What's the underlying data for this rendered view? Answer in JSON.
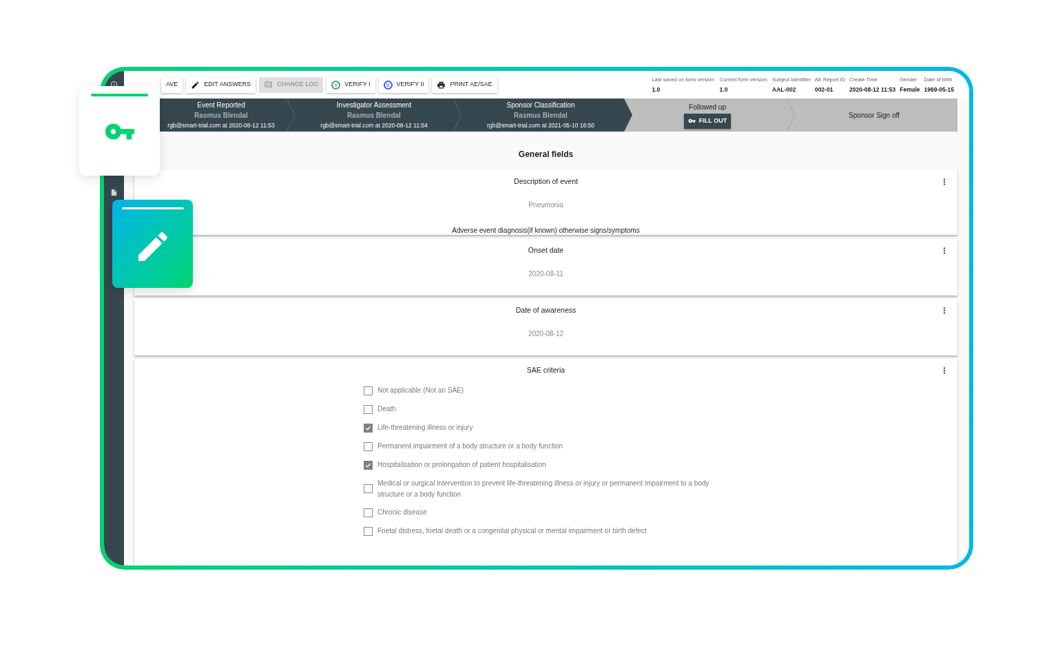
{
  "toolbar": {
    "buttons": [
      {
        "kind": "plain",
        "label": "AVE",
        "disabled": false
      },
      {
        "kind": "pencil",
        "label": "EDIT ANSWERS",
        "disabled": false
      },
      {
        "kind": "comment",
        "label": "CHANGE LOG",
        "disabled": true
      },
      {
        "kind": "verify",
        "label": "VERIFY I",
        "badge": "V",
        "color": "#4c9a7f",
        "disabled": false
      },
      {
        "kind": "verify",
        "label": "VERIFY II",
        "badge": "V",
        "color": "#3d5afe",
        "disabled": false
      },
      {
        "kind": "print",
        "label": "PRINT AE/SAE",
        "disabled": false
      }
    ]
  },
  "record_info": [
    {
      "label": "Last saved on form version:",
      "value": "1.0"
    },
    {
      "label": "Current form version:",
      "value": "1.0"
    },
    {
      "label": "Subject Identifier",
      "value": "AAL-002"
    },
    {
      "label": "AE Report ID",
      "value": "002-01"
    },
    {
      "label": "Create Time",
      "value": "2020-08-12 11:53"
    },
    {
      "label": "Gender",
      "value": "Female"
    },
    {
      "label": "Date of birth",
      "value": "1969-05-15"
    }
  ],
  "steps": [
    {
      "completed": true,
      "title": "Event Reported",
      "name": "Rasmus Blendal",
      "detail": "rgb@smart-trial.com at 2020-08-12 11:53"
    },
    {
      "completed": true,
      "title": "Investigator Assessment",
      "name": "Rasmus Blendal",
      "detail": "rgb@smart-trial.com at 2020-08-12 11:54"
    },
    {
      "completed": true,
      "title": "Sponsor Classification",
      "name": "Rasmus Blendal",
      "detail": "rgb@smart-trial.com at 2021-05-10 16:50"
    },
    {
      "completed": false,
      "title": "Followed up",
      "button": "FILL OUT"
    },
    {
      "completed": false,
      "title": "Sponsor Sign off"
    }
  ],
  "section_title": "General fields",
  "fields": [
    {
      "kind": "text",
      "label": "Description of event",
      "value": "Pneumonia",
      "hint": "Adverse event diagnosis(if known) otherwise signs/symptoms"
    },
    {
      "kind": "text",
      "label": "Onset date",
      "value": "2020-08-11"
    },
    {
      "kind": "text",
      "label": "Date of awareness",
      "value": "2020-08-12"
    },
    {
      "kind": "checklist",
      "label": "SAE criteria",
      "options": [
        {
          "label": "Not applicable (Not an SAE)",
          "checked": false
        },
        {
          "label": "Death",
          "checked": false
        },
        {
          "label": "Life-threatening illness or injury",
          "checked": true
        },
        {
          "label": "Permanent impairment of a body structure or a body function",
          "checked": false
        },
        {
          "label": "Hospitalisation or prolongation of patient hospitalisation",
          "checked": true
        },
        {
          "label": "Medical or surgical intervention to prevent life-threatening illness or injury or permanent impairment to a body structure or a body function",
          "checked": false
        },
        {
          "label": "Chronic disease",
          "checked": false
        },
        {
          "label": "Foetal distress, foetal death or a congenital physical or mental impairment or birth defect",
          "checked": false
        }
      ]
    }
  ]
}
